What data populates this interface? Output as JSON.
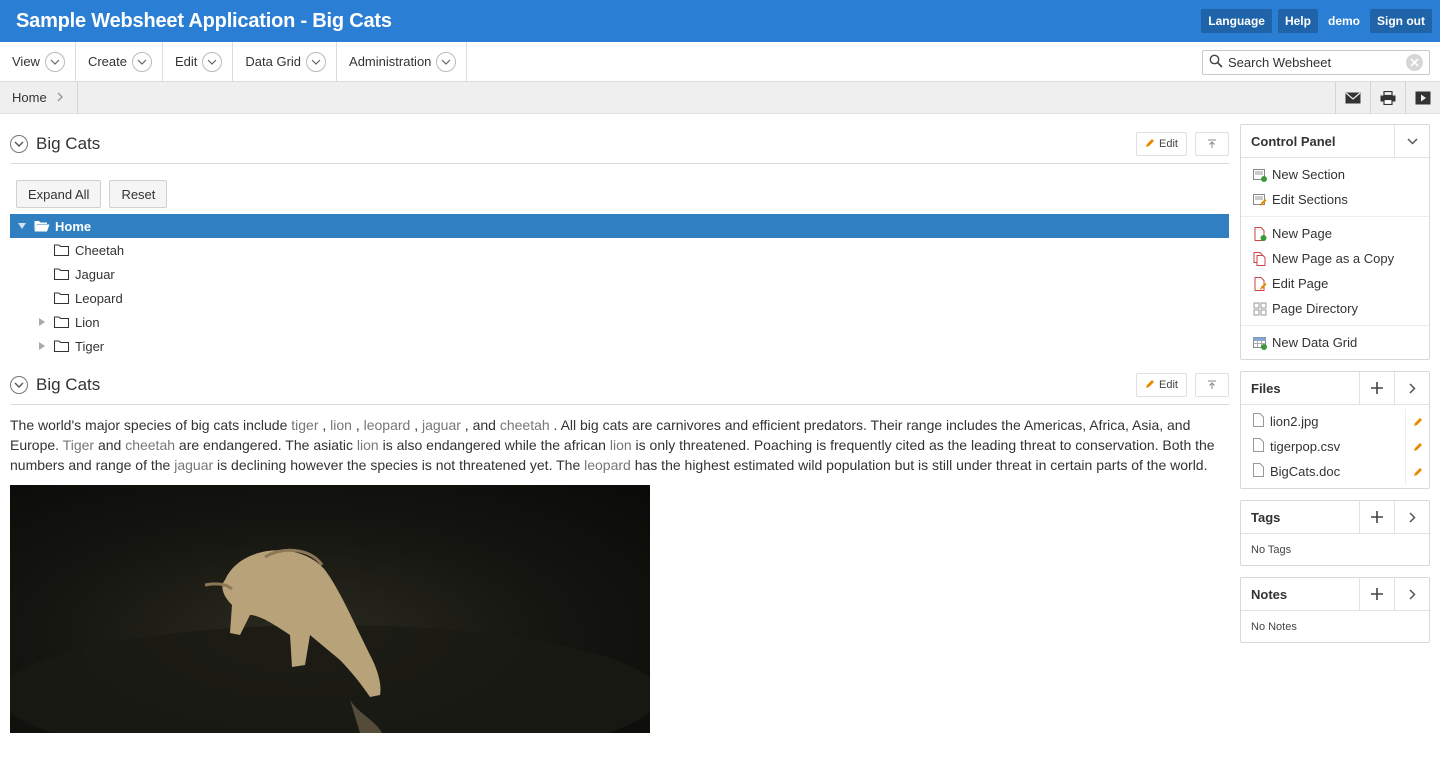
{
  "header": {
    "title": "Sample Websheet Application - Big Cats",
    "language": "Language",
    "help": "Help",
    "user": "demo",
    "signout": "Sign out"
  },
  "menu": {
    "items": [
      "View",
      "Create",
      "Edit",
      "Data Grid",
      "Administration"
    ],
    "search_placeholder": "Search Websheet"
  },
  "breadcrumb": {
    "home": "Home"
  },
  "section1": {
    "title": "Big Cats",
    "edit_label": "Edit",
    "expand_all": "Expand All",
    "reset": "Reset",
    "tree": {
      "root": "Home",
      "children": [
        "Cheetah",
        "Jaguar",
        "Leopard",
        "Lion",
        "Tiger"
      ]
    }
  },
  "section2": {
    "title": "Big Cats",
    "edit_label": "Edit",
    "text": {
      "p1": "The world's major species of big cats include ",
      "l_tiger": "tiger",
      "s1": " , ",
      "l_lion": "lion",
      "s2": " , ",
      "l_leopard": "leopard",
      "s3": " , ",
      "l_jaguar": "jaguar",
      "s4": " , and ",
      "l_cheetah": "cheetah",
      "p2": " .  All big cats are carnivores and efficient predators.  Their range includes the Americas, Africa, Asia, and Europe.  ",
      "l_tiger2": "Tiger",
      "p3": " and ",
      "l_cheetah2": "cheetah",
      "p4": " are endangered.  The asiatic ",
      "l_lion2": "lion",
      "p5": " is also endangered while the african ",
      "l_lion3": "lion",
      "p6": " is only threatened.  Poaching is frequently cited as the leading threat to conservation.  Both the numbers and range of the ",
      "l_jaguar2": "jaguar",
      "p7": " is declining however the species is not threatened yet.  The ",
      "l_leopard2": "leopard",
      "p8": " has the highest estimated wild population but is still under threat in certain parts of the world."
    }
  },
  "control_panel": {
    "title": "Control Panel",
    "groups": [
      [
        "New Section",
        "Edit Sections"
      ],
      [
        "New Page",
        "New Page as a Copy",
        "Edit Page",
        "Page Directory"
      ],
      [
        "New Data Grid"
      ]
    ]
  },
  "files": {
    "title": "Files",
    "items": [
      "lion2.jpg",
      "tigerpop.csv",
      "BigCats.doc"
    ]
  },
  "tags": {
    "title": "Tags",
    "empty": "No Tags"
  },
  "notes": {
    "title": "Notes",
    "empty": "No Notes"
  }
}
